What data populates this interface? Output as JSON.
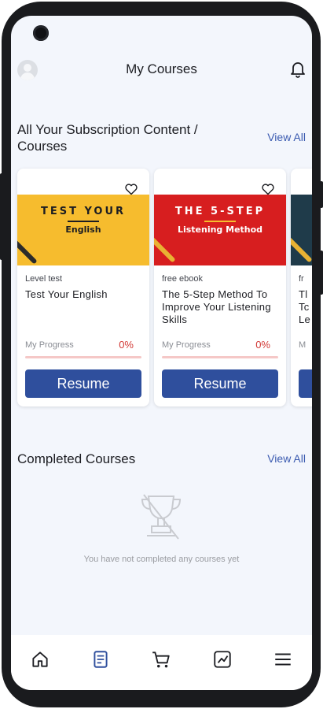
{
  "header": {
    "title": "My Courses"
  },
  "subscriptions": {
    "title": "All Your Subscription Content / Courses",
    "title_line1": "All Your Subscription Content /",
    "title_line2": "Courses",
    "view_all": "View All",
    "cards": [
      {
        "banner_line1": "TEST YOUR",
        "banner_line2": "English",
        "banner_color": "#f6bc2e",
        "category": "Level test",
        "title": "Test Your English",
        "progress_label": "My Progress",
        "progress_value": "0%",
        "progress_fraction": 0,
        "button": "Resume"
      },
      {
        "banner_line1": "THE 5-STEP",
        "banner_line2": "Listening Method",
        "banner_color": "#d71e1f",
        "category": "free ebook",
        "title": "The 5-Step Method To Improve Your Listening Skills",
        "progress_label": "My Progress",
        "progress_value": "0%",
        "progress_fraction": 0,
        "button": "Resume"
      },
      {
        "banner_color": "#1f3b4a",
        "category": "fr",
        "title_partial": [
          "Tl",
          "Tc",
          "Le"
        ],
        "progress_label": "M"
      }
    ]
  },
  "completed": {
    "title": "Completed Courses",
    "view_all": "View All",
    "empty_icon": "trophy-icon",
    "empty_text": "You have not completed any courses yet"
  },
  "nav": [
    {
      "icon": "home-icon"
    },
    {
      "icon": "courses-icon",
      "active": true
    },
    {
      "icon": "cart-icon"
    },
    {
      "icon": "chart-icon"
    },
    {
      "icon": "menu-icon"
    }
  ],
  "colors": {
    "accent": "#2f4f9d",
    "progress_red": "#d23a36",
    "link": "#3a5ab0",
    "background": "#f3f6fc"
  }
}
